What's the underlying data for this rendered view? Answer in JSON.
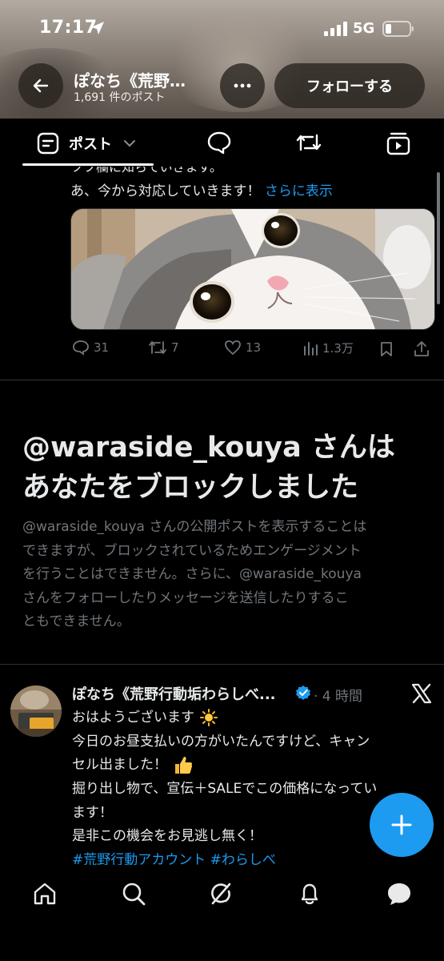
{
  "status_bar": {
    "time": "17:17",
    "network": "5G"
  },
  "profile_header": {
    "name": "ぽなち《荒野…",
    "post_count": "1,691 件のポスト",
    "follow_label": "フォローする"
  },
  "tabs": {
    "posts_label": "ポスト"
  },
  "faded_post": {
    "cut_text": "ツフ欄に知らていきます。",
    "text": "あ、今から対応していきます！",
    "show_more": "さらに表示",
    "replies": "31",
    "reposts": "7",
    "likes": "13",
    "views": "1.3万"
  },
  "blocked": {
    "title_line1": "@waraside_kouya さんは",
    "title_line2": "あなたをブロックしました",
    "desc_line1": "@waraside_kouya さんの公開ポストを表示することは",
    "desc_line2": "できますが、ブロックされているためエンゲージメント",
    "desc_line3": "を行うことはできません。さらに、@waraside_kouya",
    "desc_line4": "さんをフォローしたりメッセージを送信したりするこ",
    "desc_line5": "ともできません。"
  },
  "pinned_post": {
    "name": "ぽなち《荒野行動垢わらしべ...",
    "time": "· 4 時間",
    "line1": "おはようございます",
    "line2": "今日のお昼支払いの方がいたんですけど、キャン",
    "line3": "セル出ました！",
    "line4": "掘り出し物で、宣伝＋SALEでこの価格になってい",
    "line5": "ます！",
    "line6": "是非この機会をお見逃し無く！",
    "hashtag1": "#荒野行動アカウント",
    "hashtag2": "#わらしべ"
  },
  "colors": {
    "accent": "#1d9bf0",
    "muted": "#71767b",
    "background": "#000000"
  }
}
